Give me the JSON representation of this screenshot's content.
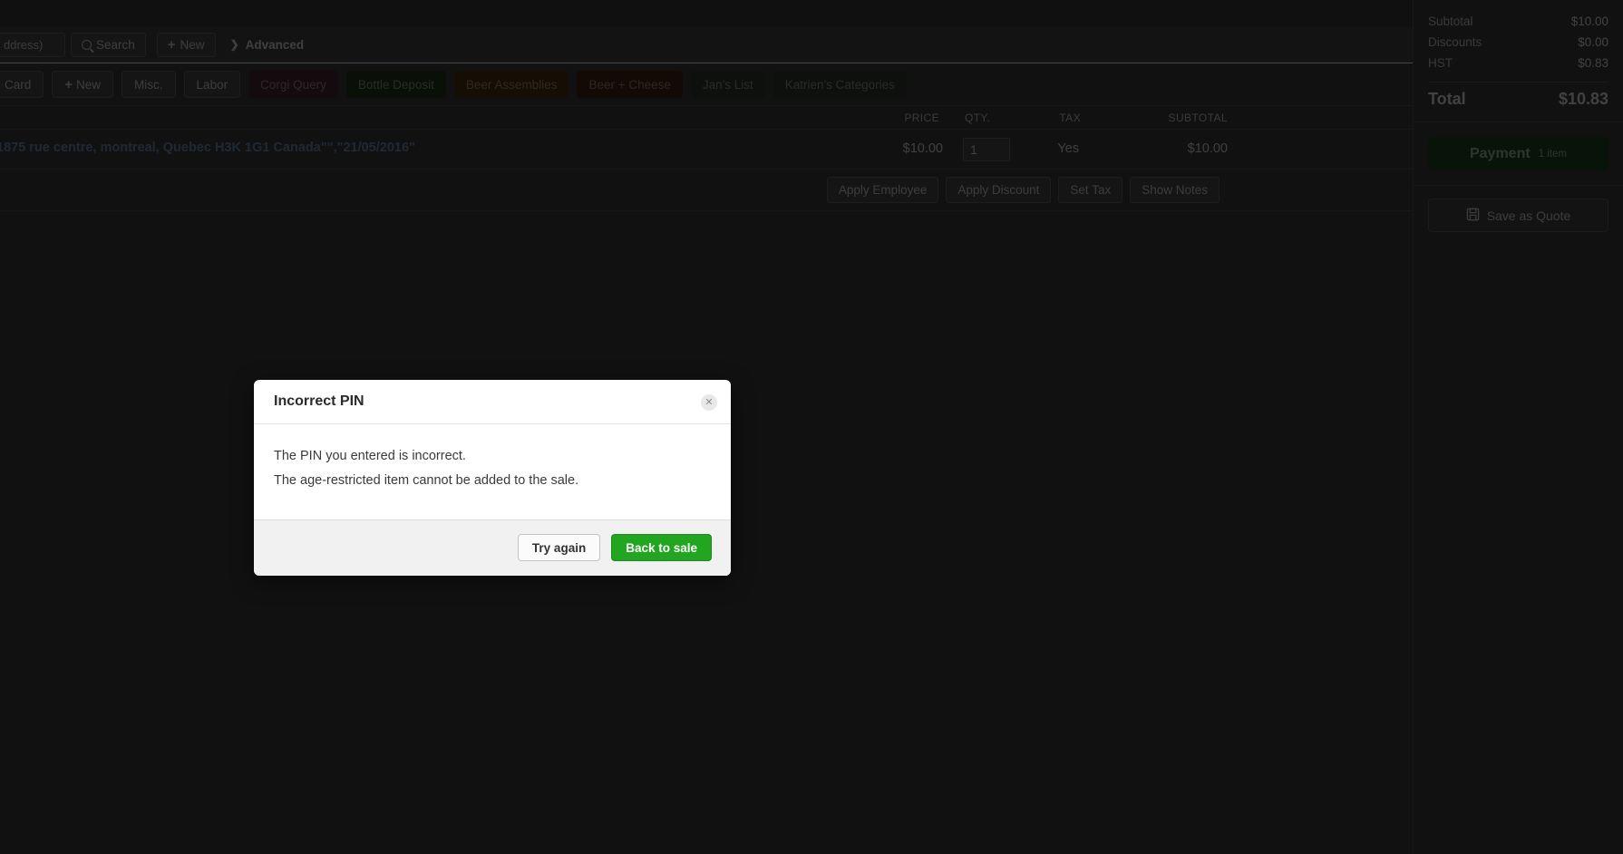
{
  "search_bar": {
    "customer_input_value": "ddress)",
    "search_label": "Search",
    "new_label": "New",
    "advanced_label": "Advanced",
    "search_icon": "search-icon",
    "plus_icon": "plus-icon",
    "chevron_icon": "chevron-right-icon"
  },
  "category_bar": {
    "buttons": [
      {
        "label": "Card",
        "style": "plain"
      },
      {
        "label": "New",
        "style": "plain",
        "icon": "plus-icon"
      },
      {
        "label": "Misc.",
        "style": "plain"
      },
      {
        "label": "Labor",
        "style": "plain"
      },
      {
        "label": "Corgi Query",
        "style": "custom",
        "bg": "#4a2836",
        "fg": "#a98a95"
      },
      {
        "label": "Bottle Deposit",
        "style": "custom",
        "bg": "#253819",
        "fg": "#8aa37a"
      },
      {
        "label": "Beer Assemblies",
        "style": "custom",
        "bg": "#4a3410",
        "fg": "#ab9064"
      },
      {
        "label": "Beer + Cheese",
        "style": "custom",
        "bg": "#4a2414",
        "fg": "#ab7f6b"
      },
      {
        "label": "Jan's List",
        "style": "custom",
        "bg": "#333a33",
        "fg": "#8d9b8d"
      },
      {
        "label": "Katrien's Categories",
        "style": "custom",
        "bg": "#333a33",
        "fg": "#8d9b8d"
      }
    ]
  },
  "columns": {
    "price": "PRICE",
    "qty": "QTY.",
    "tax": "TAX",
    "subtotal": "SUBTOTAL"
  },
  "line_item": {
    "description": "1875 rue centre, montreal, Quebec H3K 1G1 Canada\"\",\"21/05/2016\"",
    "price": "$10.00",
    "qty": "1",
    "tax": "Yes",
    "subtotal": "$10.00"
  },
  "item_actions": [
    {
      "label": "Apply Employee"
    },
    {
      "label": "Apply Discount"
    },
    {
      "label": "Set Tax"
    },
    {
      "label": "Show Notes"
    }
  ],
  "totals": {
    "subtotal_label": "Subtotal",
    "subtotal_value": "$10.00",
    "discounts_label": "Discounts",
    "discounts_value": "$0.00",
    "hst_label": "HST",
    "hst_value": "$0.83",
    "total_label": "Total",
    "total_value": "$10.83"
  },
  "payment": {
    "label": "Payment",
    "count": "1 item",
    "accent": "#1d4620"
  },
  "quote": {
    "label": "Save as Quote",
    "icon": "save-quote-icon"
  },
  "modal": {
    "title": "Incorrect PIN",
    "close_icon": "close-icon",
    "line1": "The PIN you entered is incorrect.",
    "line2": "The age-restricted item cannot be added to the sale.",
    "secondary_button": "Try again",
    "primary_button": "Back to sale",
    "primary_color": "#22a621"
  }
}
